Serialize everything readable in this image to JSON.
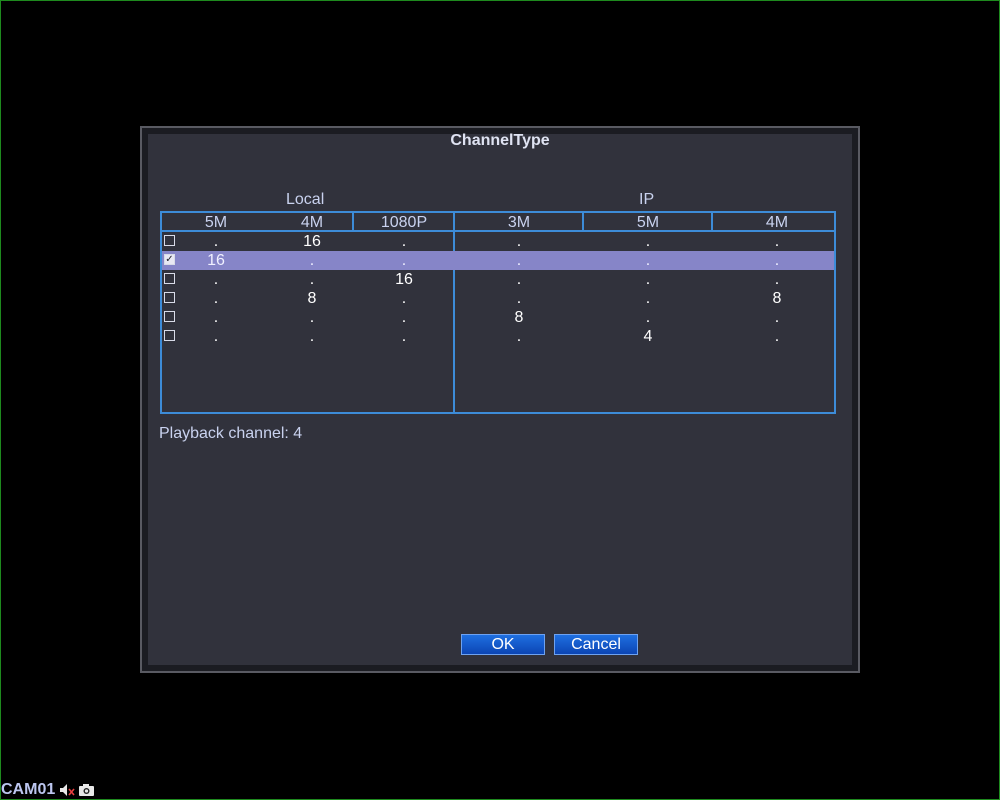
{
  "dialog": {
    "title": "ChannelType",
    "groups": {
      "local": "Local",
      "ip": "IP"
    },
    "columns": [
      "5M",
      "4M",
      "1080P",
      "3M",
      "5M",
      "4M"
    ],
    "rows": [
      {
        "checked": false,
        "cells": [
          ".",
          "16",
          ".",
          ".",
          ".",
          "."
        ]
      },
      {
        "checked": true,
        "cells": [
          "16",
          ".",
          ".",
          ".",
          ".",
          "."
        ]
      },
      {
        "checked": false,
        "cells": [
          ".",
          ".",
          "16",
          ".",
          ".",
          "."
        ]
      },
      {
        "checked": false,
        "cells": [
          ".",
          "8",
          ".",
          ".",
          ".",
          "8"
        ]
      },
      {
        "checked": false,
        "cells": [
          ".",
          ".",
          ".",
          "8",
          ".",
          "."
        ]
      },
      {
        "checked": false,
        "cells": [
          ".",
          ".",
          ".",
          ".",
          "4",
          "."
        ]
      }
    ],
    "playback_text": "Playback channel: 4",
    "ok_label": "OK",
    "cancel_label": "Cancel"
  },
  "status_bar": {
    "camera_label": "CAM01",
    "icons": [
      "speaker-muted-icon",
      "camera-icon"
    ]
  }
}
